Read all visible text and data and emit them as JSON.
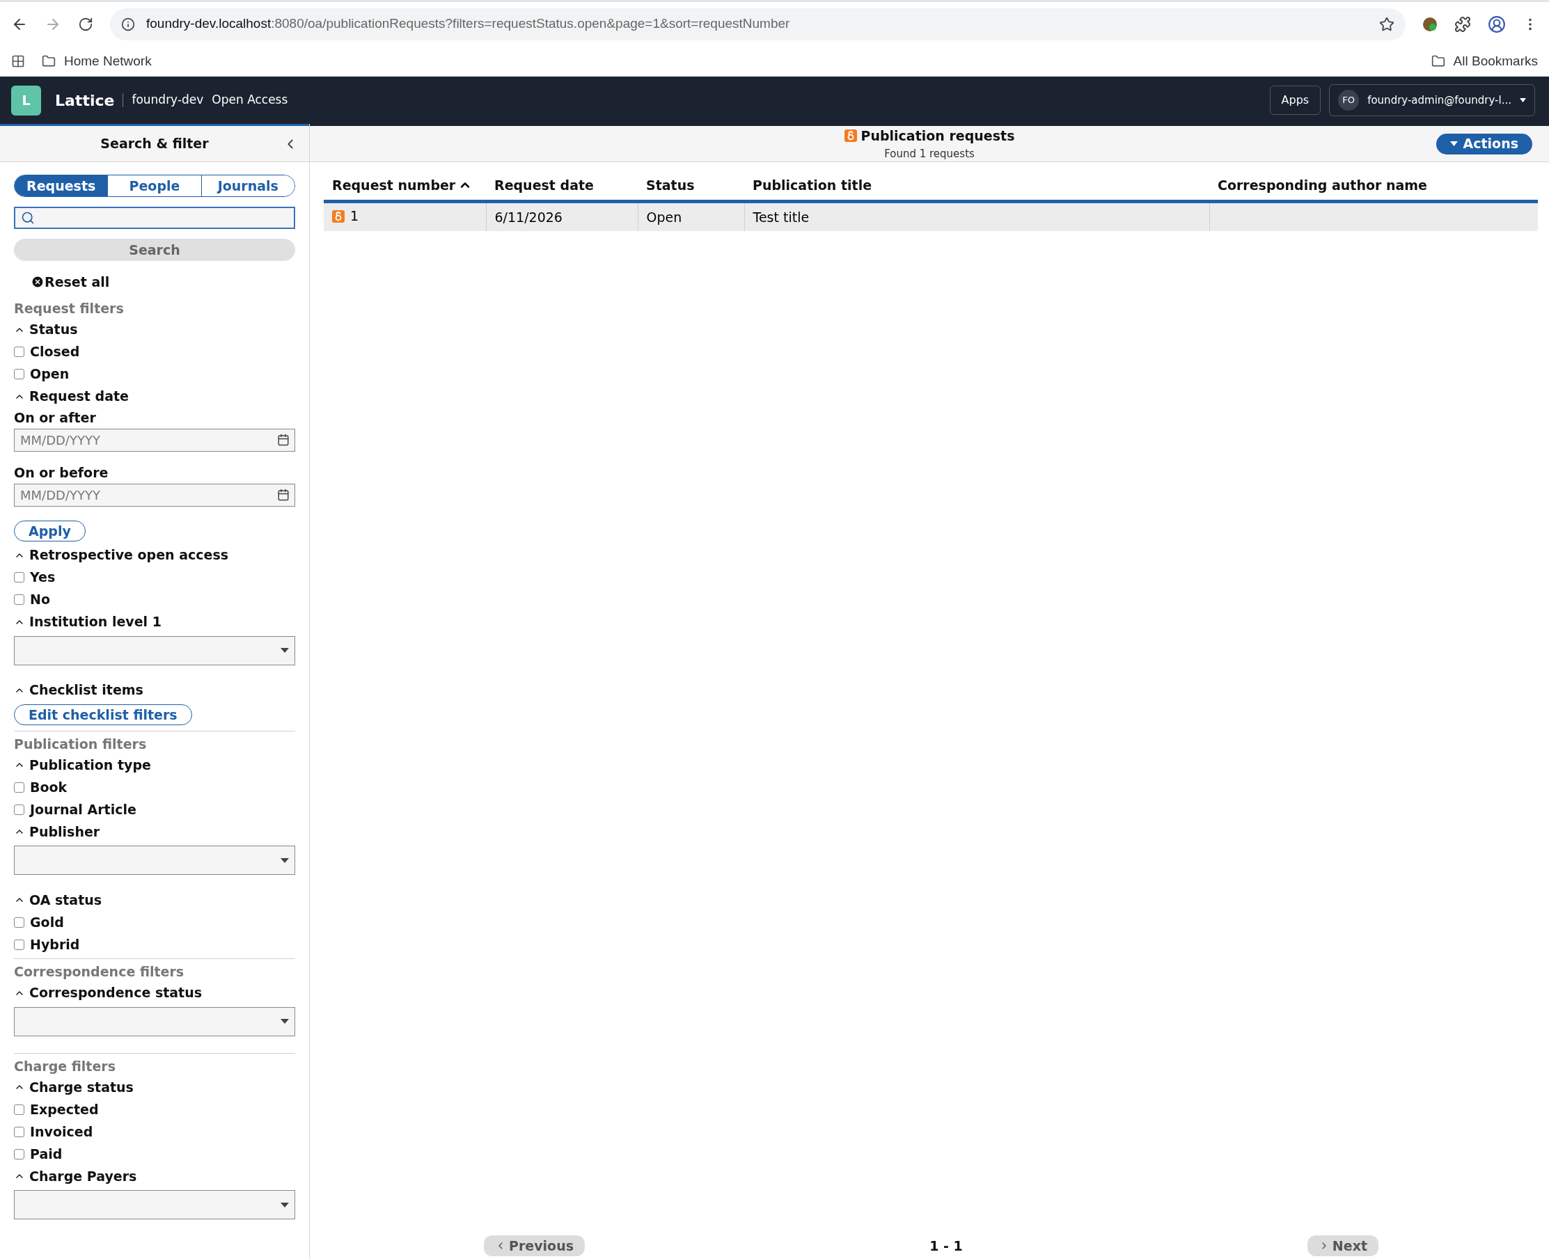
{
  "browser": {
    "url_host": "foundry-dev.localhost",
    "url_rest": ":8080/oa/publicationRequests?filters=requestStatus.open&page=1&sort=requestNumber",
    "bookmarks": [
      "Home Network"
    ],
    "all_bookmarks": "All Bookmarks"
  },
  "app_header": {
    "logo_letter": "L",
    "app_name": "Lattice",
    "tenant": "foundry-dev",
    "module": "Open Access",
    "apps_button": "Apps",
    "user_initials": "FO",
    "user_name": "foundry-admin@foundry-l..."
  },
  "sidebar": {
    "title": "Search & filter",
    "segments": [
      {
        "label": "Requests",
        "selected": true
      },
      {
        "label": "People",
        "selected": false
      },
      {
        "label": "Journals",
        "selected": false
      }
    ],
    "search_button": "Search",
    "reset": "Reset all",
    "filters": [
      {
        "kind": "group",
        "label": "Request filters"
      },
      {
        "kind": "section",
        "label": "Status",
        "expanded": true
      },
      {
        "kind": "checkbox",
        "label": "Closed",
        "checked": false
      },
      {
        "kind": "checkbox",
        "label": "Open",
        "checked": false
      },
      {
        "kind": "section",
        "label": "Request date",
        "expanded": true
      },
      {
        "kind": "date",
        "label": "On or after",
        "placeholder": "MM/DD/YYYY"
      },
      {
        "kind": "date",
        "label": "On or before",
        "placeholder": "MM/DD/YYYY"
      },
      {
        "kind": "button",
        "label": "Apply"
      },
      {
        "kind": "section",
        "label": "Retrospective open access",
        "expanded": true
      },
      {
        "kind": "checkbox",
        "label": "Yes",
        "checked": false
      },
      {
        "kind": "checkbox",
        "label": "No",
        "checked": false
      },
      {
        "kind": "section",
        "label": "Institution level 1",
        "expanded": true
      },
      {
        "kind": "select"
      },
      {
        "kind": "section",
        "label": "Checklist items",
        "expanded": true
      },
      {
        "kind": "button",
        "label": "Edit checklist filters"
      },
      {
        "kind": "group",
        "label": "Publication filters"
      },
      {
        "kind": "section",
        "label": "Publication type",
        "expanded": true
      },
      {
        "kind": "checkbox",
        "label": "Book",
        "checked": false
      },
      {
        "kind": "checkbox",
        "label": "Journal Article",
        "checked": false
      },
      {
        "kind": "section",
        "label": "Publisher",
        "expanded": true
      },
      {
        "kind": "select"
      },
      {
        "kind": "section",
        "label": "OA status",
        "expanded": true
      },
      {
        "kind": "checkbox",
        "label": "Gold",
        "checked": false
      },
      {
        "kind": "checkbox",
        "label": "Hybrid",
        "checked": false
      },
      {
        "kind": "group",
        "label": "Correspondence filters"
      },
      {
        "kind": "section",
        "label": "Correspondence status",
        "expanded": true
      },
      {
        "kind": "select"
      },
      {
        "kind": "group",
        "label": "Charge filters"
      },
      {
        "kind": "section",
        "label": "Charge status",
        "expanded": true
      },
      {
        "kind": "checkbox",
        "label": "Expected",
        "checked": false
      },
      {
        "kind": "checkbox",
        "label": "Invoiced",
        "checked": false
      },
      {
        "kind": "checkbox",
        "label": "Paid",
        "checked": false
      },
      {
        "kind": "section",
        "label": "Charge Payers",
        "expanded": true
      },
      {
        "kind": "select"
      }
    ]
  },
  "main": {
    "title": "Publication requests",
    "subtitle": "Found 1 requests",
    "actions_button": "Actions",
    "table": {
      "columns": [
        {
          "label": "Request number",
          "sorted": true
        },
        {
          "label": "Request date",
          "sorted": false
        },
        {
          "label": "Status",
          "sorted": false
        },
        {
          "label": "Publication title",
          "sorted": false
        },
        {
          "label": "Corresponding author name",
          "sorted": false
        }
      ],
      "rows": [
        {
          "request_number": "1",
          "request_date": "6/11/2026",
          "status": "Open",
          "publication_title": "Test title"
        }
      ]
    },
    "pagination": {
      "previous": "Previous",
      "range": "1 - 1",
      "next": "Next"
    }
  }
}
